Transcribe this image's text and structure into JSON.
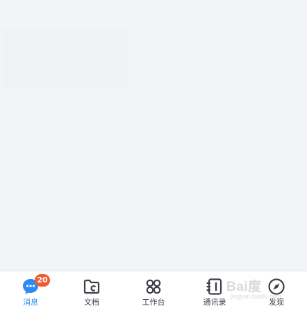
{
  "colors": {
    "accent": "#2a8cf2",
    "badge": "#f25a2f",
    "tab_text": "#3b3f46",
    "background": "#f3f4f6"
  },
  "tabbar": {
    "items": [
      {
        "label": "消息",
        "icon": "chat-bubble-icon",
        "active": true,
        "badge": "20"
      },
      {
        "label": "文档",
        "icon": "folder-doc-icon",
        "active": false
      },
      {
        "label": "工作台",
        "icon": "apps-grid-icon",
        "active": false
      },
      {
        "label": "通讯录",
        "icon": "contacts-book-icon",
        "active": false
      },
      {
        "label": "发现",
        "icon": "compass-icon",
        "active": false
      }
    ]
  },
  "watermark": {
    "text": "Bai度",
    "url": "jingyan.baidu.com"
  }
}
